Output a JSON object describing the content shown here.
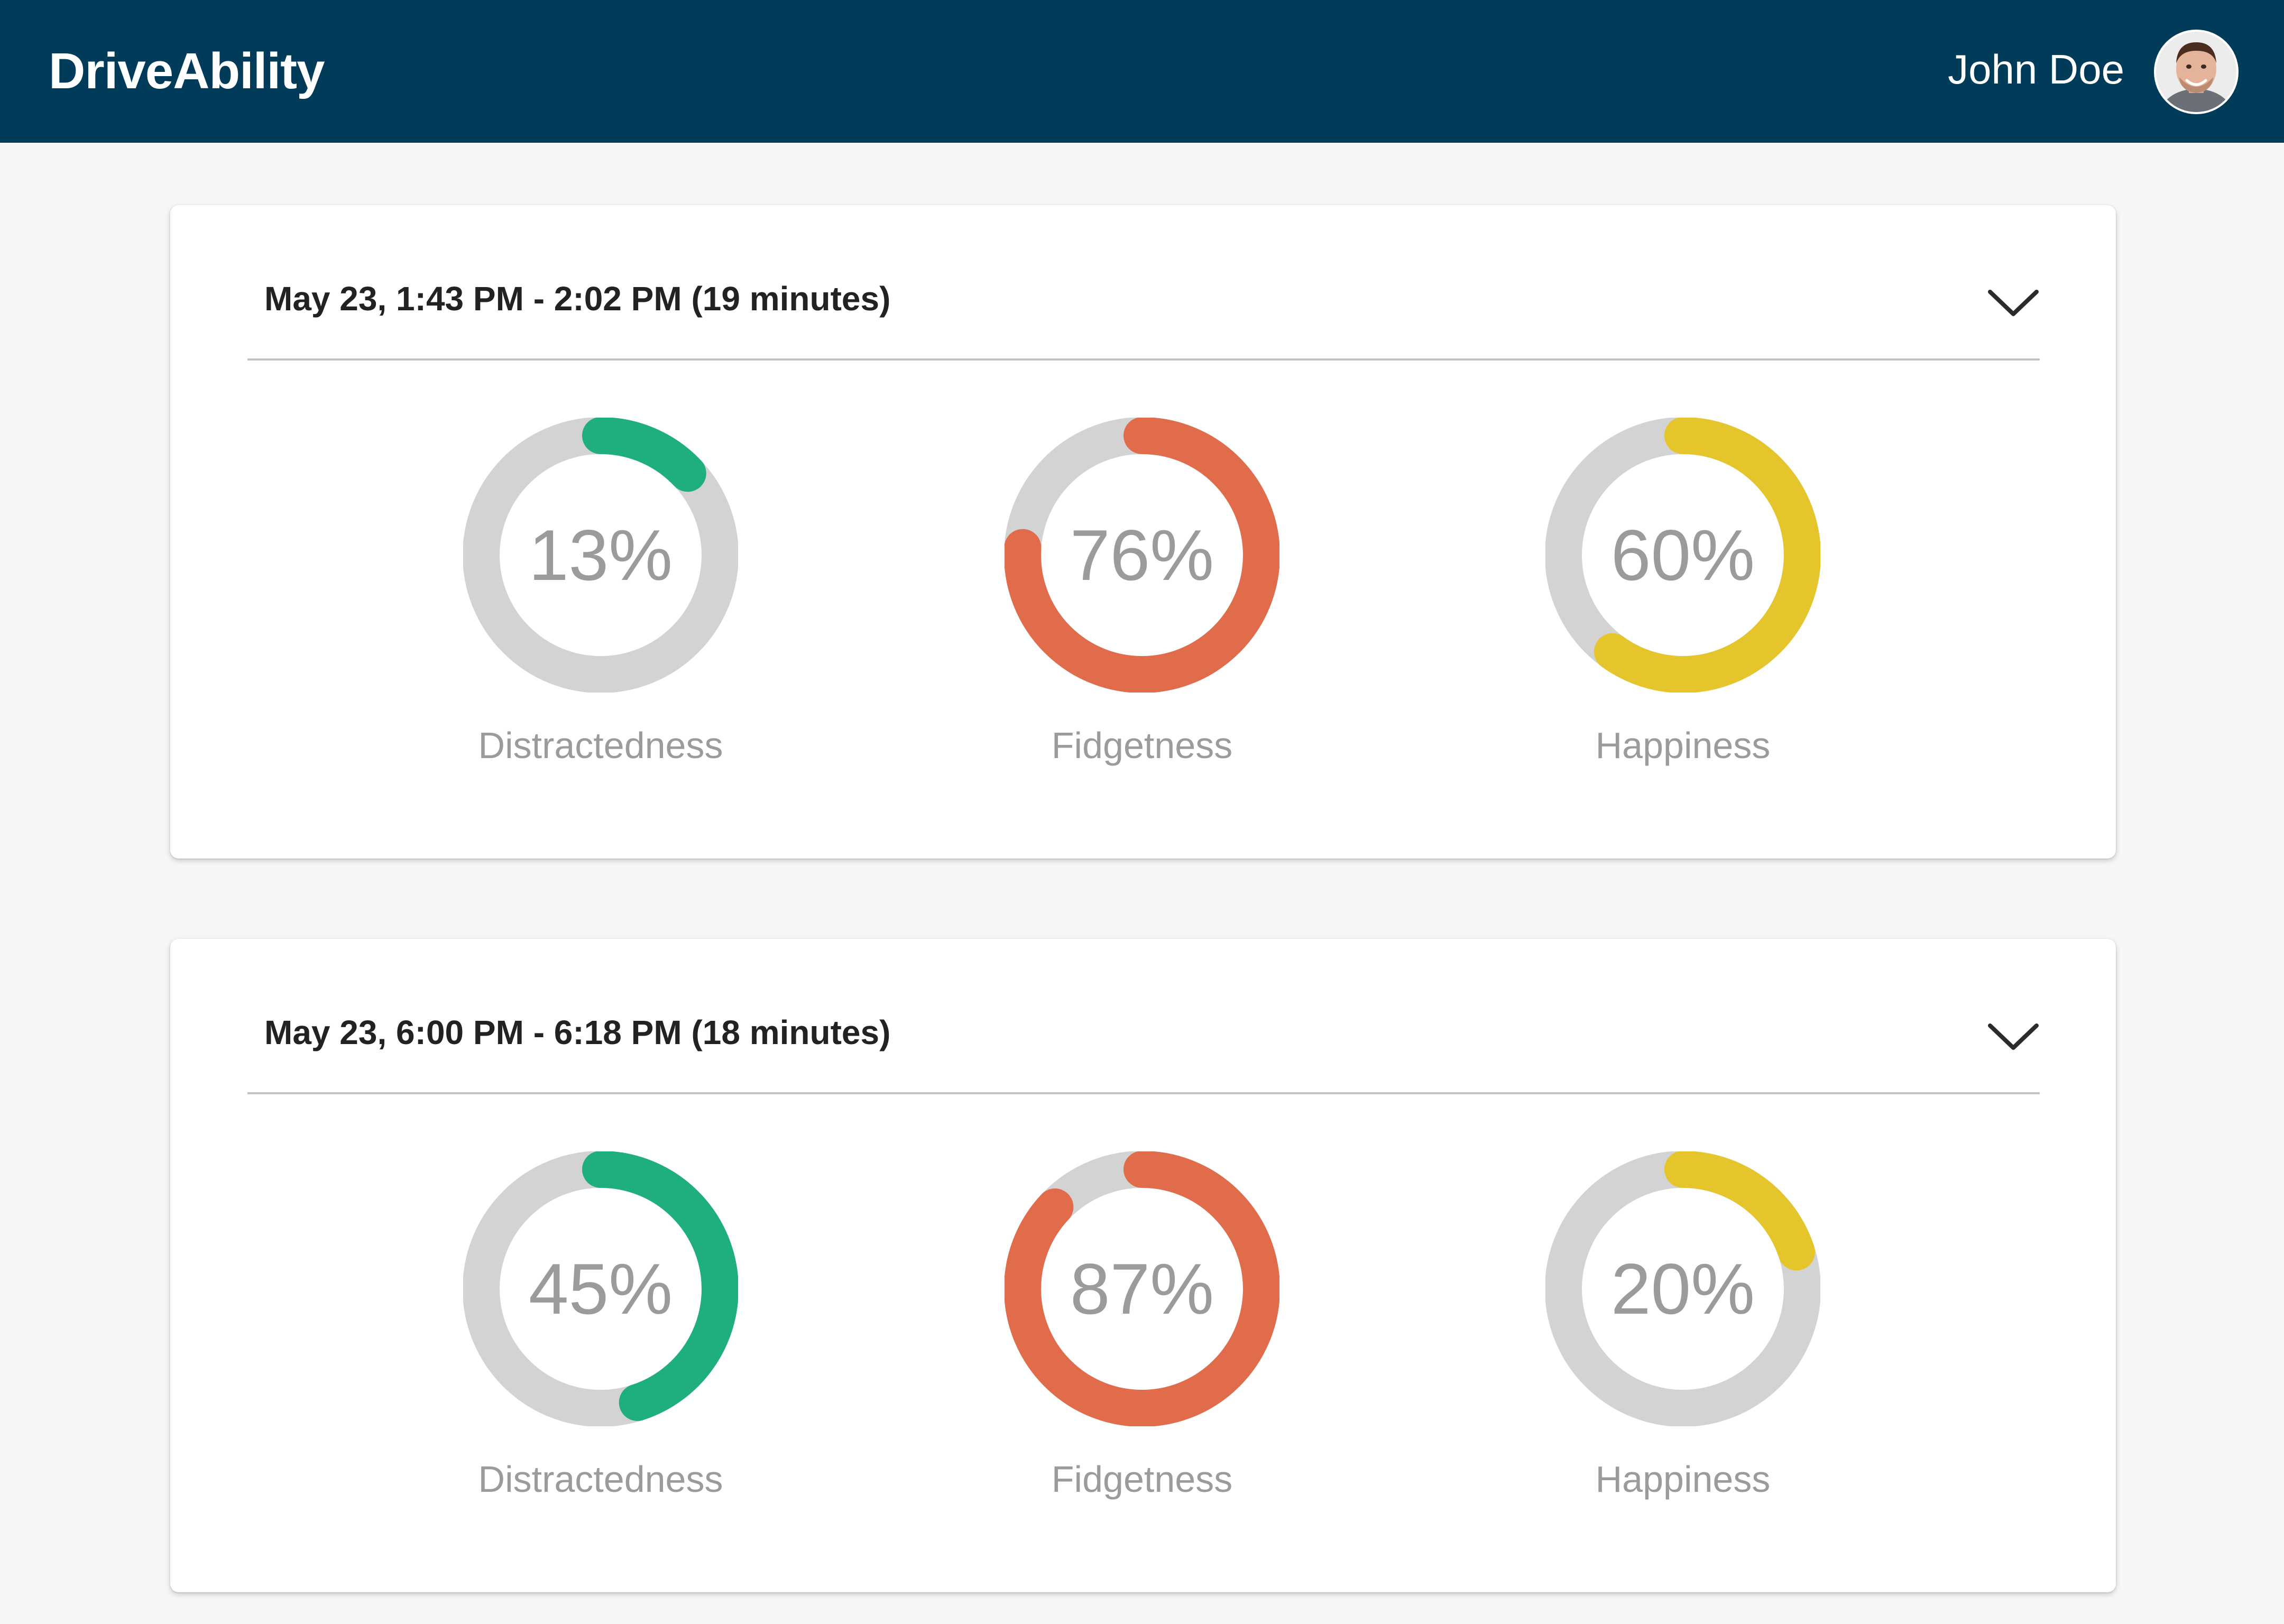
{
  "app": {
    "title": "DriveAbility"
  },
  "user": {
    "name": "John Doe",
    "avatar_icon": "user-avatar-photo"
  },
  "colors": {
    "header_bg": "#003b59",
    "track": "#d3d3d3",
    "distractedness": "#1eae80",
    "fidgetness": "#e16c4c",
    "happiness": "#e4c52b"
  },
  "trips": [
    {
      "title": "May 23, 1:43 PM - 2:02 PM (19 minutes)",
      "expand_icon": "chevron-down-icon",
      "metrics": [
        {
          "label": "Distractedness",
          "value_text": "13%",
          "value": 13,
          "color_key": "distractedness"
        },
        {
          "label": "Fidgetness",
          "value_text": "76%",
          "value": 76,
          "color_key": "fidgetness"
        },
        {
          "label": "Happiness",
          "value_text": "60%",
          "value": 60,
          "color_key": "happiness"
        }
      ]
    },
    {
      "title": "May 23, 6:00 PM - 6:18 PM (18 minutes)",
      "expand_icon": "chevron-down-icon",
      "metrics": [
        {
          "label": "Distractedness",
          "value_text": "45%",
          "value": 45,
          "color_key": "distractedness"
        },
        {
          "label": "Fidgetness",
          "value_text": "87%",
          "value": 87,
          "color_key": "fidgetness"
        },
        {
          "label": "Happiness",
          "value_text": "20%",
          "value": 20,
          "color_key": "happiness"
        }
      ]
    }
  ]
}
